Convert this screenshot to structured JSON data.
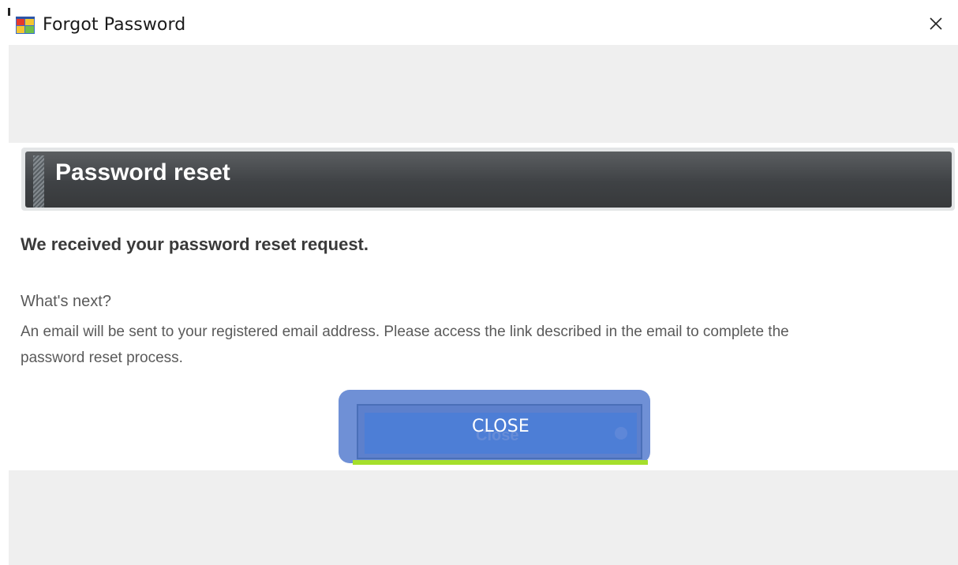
{
  "window": {
    "title": "Forgot Password",
    "icon": "app-window-icon",
    "close_icon": "close-icon"
  },
  "panel": {
    "heading": "Password reset"
  },
  "content": {
    "confirmation": "We received your password reset request.",
    "whats_next": "What's next?",
    "instructions": "An email will be sent to your registered email address. Please access the link described in the email to complete the password reset process."
  },
  "button": {
    "label": "CLOSE",
    "ghost_label": "Close"
  },
  "colors": {
    "header_bar": "#3f4245",
    "button_blue": "#4d7ed6",
    "button_outline": "#6f90d6",
    "button_underline": "#a5df2b",
    "band_gray": "#efefef"
  }
}
